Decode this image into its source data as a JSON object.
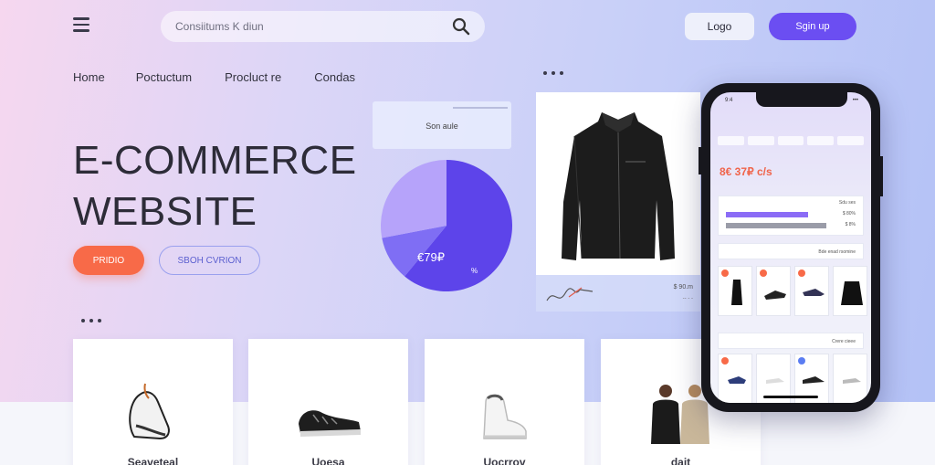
{
  "header": {
    "search_placeholder": "Consiitums K diun",
    "login_label": "Logo",
    "signup_label": "Sgin up"
  },
  "nav": {
    "items": [
      "Home",
      "Poctuctum",
      "Procluct re",
      "Condas"
    ]
  },
  "hero": {
    "title_line1": "E-COMMERCE",
    "title_line2": "WEBSITE",
    "primary_button": "PRIDIO",
    "secondary_button": "SBOH CVRION"
  },
  "stat_card": {
    "label": "Son aule"
  },
  "pie_chart": {
    "center_label": "€79₽",
    "small_label": "%",
    "slices": [
      {
        "value": 0.61,
        "color": "#5d44ea"
      },
      {
        "value": 0.11,
        "color": "#7f6ef4"
      },
      {
        "value": 0.28,
        "color": "#b6a3fa"
      }
    ]
  },
  "jacket_card": {
    "price": "$ 90.m",
    "meta": "-- - -"
  },
  "phone": {
    "time": "9:4",
    "status": "•••",
    "promo": "8€ 37₽ c/s",
    "panel_rows": [
      "Sdu ses",
      "$ 80%",
      "$ 8%"
    ],
    "section_labels": [
      "Bde enad rsomine",
      "Crere cieee"
    ]
  },
  "products": [
    {
      "name": "Seaveteal"
    },
    {
      "name": "Uoesa"
    },
    {
      "name": "Uocrrov"
    },
    {
      "name": "dait"
    }
  ],
  "colors": {
    "accent_purple": "#6b4ef2",
    "accent_orange": "#f86a48"
  }
}
